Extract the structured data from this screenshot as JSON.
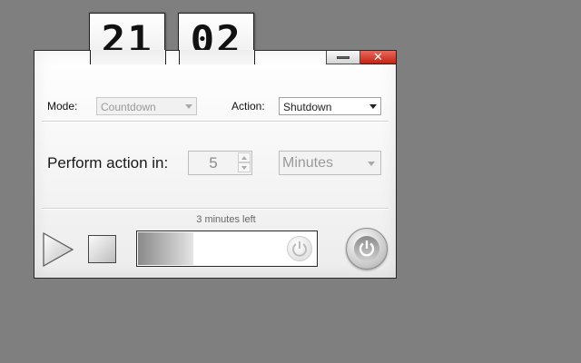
{
  "clock": {
    "hours": "21",
    "minutes": "02"
  },
  "window": {
    "minimize_icon": "minimize-icon",
    "close_icon": "close-icon",
    "close_glyph": "✕"
  },
  "mode": {
    "label": "Mode:",
    "value": "Countdown"
  },
  "action": {
    "label": "Action:",
    "value": "Shutdown"
  },
  "timer": {
    "label": "Perform action in:",
    "amount": "5",
    "unit": "Minutes"
  },
  "status": {
    "text": "3 minutes left",
    "progress_fraction": 0.31
  },
  "controls": {
    "play_icon": "play-icon",
    "stop_icon": "stop-icon",
    "power_icon": "power-icon"
  },
  "colors": {
    "background": "#7f7f7f",
    "close_red": "#c42414"
  }
}
